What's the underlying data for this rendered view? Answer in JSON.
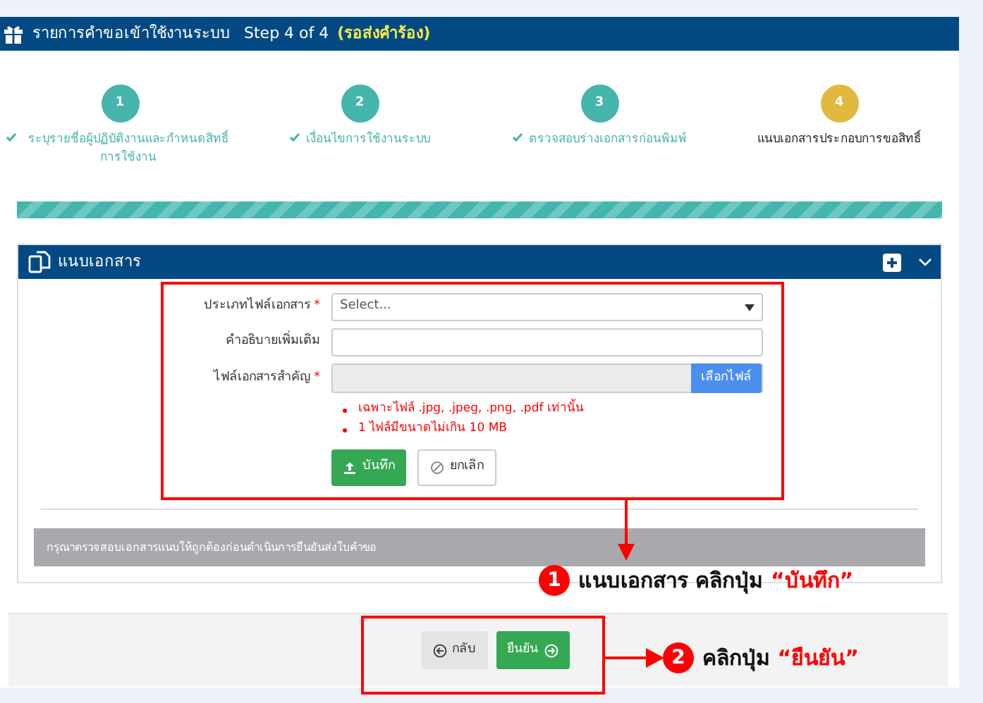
{
  "header": {
    "title": "รายการคำขอเข้าใช้งานระบบ",
    "step": "Step 4 of 4",
    "status": "(รอส่งคำร้อง)"
  },
  "steps": [
    {
      "number": "1",
      "label": "ระบุรายชื่อผู้ปฏิบัติงานและกำหนดสิทธิ์การใช้งาน",
      "completed": true,
      "selected": false
    },
    {
      "number": "2",
      "label": "เงื่อนไขการใช้งานระบบ",
      "completed": true,
      "selected": false
    },
    {
      "number": "3",
      "label": "ตรวจสอบร่างเอกสารก่อนพิมพ์",
      "completed": true,
      "selected": false
    },
    {
      "number": "4",
      "label": "แนบเอกสารประกอบการขอสิทธิ์",
      "completed": false,
      "selected": true
    }
  ],
  "progress": {
    "level": 1
  },
  "panel": {
    "title": "แนบเอกสาร",
    "fields": [
      {
        "kind": "select",
        "label": "ประเภทไฟล์เอกสาร",
        "required_mark": "*",
        "placeholder": "Select..."
      },
      {
        "kind": "text",
        "label": "คำอธิบายเพิ่มเติม"
      },
      {
        "kind": "file",
        "label": "ไฟล์เอกสารสำคัญ",
        "required_mark": "*",
        "button": "เลือกไฟล์"
      }
    ],
    "notes": [
      "เฉพาะไฟล์ .jpg, .jpeg, .png, .pdf เท่านั้น",
      "1 ไฟล์มีขนาดไม่เกิน 10 MB"
    ],
    "buttons": [
      {
        "kind": "save",
        "label": "บันทึก"
      },
      {
        "kind": "cancel",
        "label": "ยกเลิก"
      }
    ],
    "info": "กรุณาตรวจสอบเอกสารแนบให้ถูกต้องก่อนดำเนินการยืนยันส่งใบคำขอ"
  },
  "footer_buttons": [
    {
      "kind": "back",
      "label": "กลับ"
    },
    {
      "kind": "confirm",
      "label": "ยืนยัน"
    }
  ],
  "annotations": [
    {
      "number": "1",
      "text": "แนบเอกสาร คลิกปุ่ม",
      "highlight": "“บันทึก”"
    },
    {
      "number": "2",
      "text": "คลิกปุ่ม",
      "highlight": "“ยืนยัน”"
    }
  ]
}
